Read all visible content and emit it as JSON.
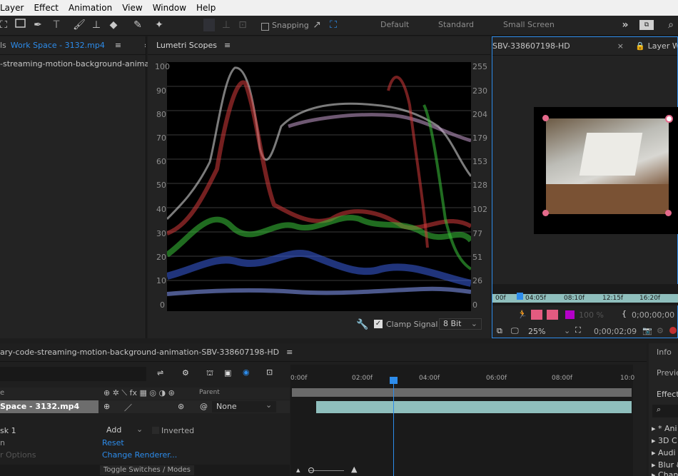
{
  "menu": [
    "Layer",
    "Effect",
    "Animation",
    "View",
    "Window",
    "Help"
  ],
  "toolbar": {
    "snapping_label": "Snapping",
    "workspaces": [
      "Default",
      "Standard",
      "Small Screen"
    ]
  },
  "project_panel": {
    "tab_prefix": "ls",
    "tab_title": "Work Space - 3132.mp4",
    "item_name": "-streaming-motion-background-animati"
  },
  "scopes_panel": {
    "title": "Lumetri Scopes",
    "left_axis": [
      "100",
      "90",
      "80",
      "70",
      "60",
      "50",
      "40",
      "30",
      "20",
      "10",
      "0"
    ],
    "right_axis": [
      "255",
      "230",
      "204",
      "179",
      "153",
      "128",
      "102",
      "77",
      "51",
      "26",
      "0"
    ],
    "clamp_label": "Clamp Signal",
    "bit_depth": "8 Bit"
  },
  "layer_panel": {
    "tab_name": "SBV-338607198-HD",
    "layer_tab": "Layer Wo",
    "ruler": [
      "00f",
      "04:05f",
      "08:10f",
      "12:15f",
      "16:20f"
    ],
    "opacity": "100 %",
    "timecode": "0;00;00;00",
    "zoom": "25%",
    "timecode2": "0;00;02;09"
  },
  "timeline": {
    "comp_title": "ary-code-streaming-motion-background-animation-SBV-338607198-HD",
    "ruler": [
      "0:00f",
      "02:00f",
      "04:00f",
      "06:00f",
      "08:00f",
      "10:0"
    ],
    "col_source": "e",
    "col_parent": "Parent",
    "layer_name": "Space - 3132.mp4",
    "parent_value": "None",
    "mask_name": "sk 1",
    "mask_mode": "Add",
    "inverted_label": "Inverted",
    "prop1": "n",
    "reset_label": "Reset",
    "prop2": "r Options",
    "change_renderer": "Change Renderer...",
    "toggle_label": "Toggle Switches / Modes"
  },
  "right_panels": {
    "info": "Info",
    "preview": "Previe",
    "effects": "Effect",
    "search_icon": "⌕",
    "effect_items": [
      "* Ani",
      "3D C",
      "Audi",
      "Blur &",
      "Chan"
    ]
  },
  "colors": {
    "accent": "#2d8ceb",
    "panel_bg": "#232323",
    "teal_bar": "#8fbfbd"
  }
}
